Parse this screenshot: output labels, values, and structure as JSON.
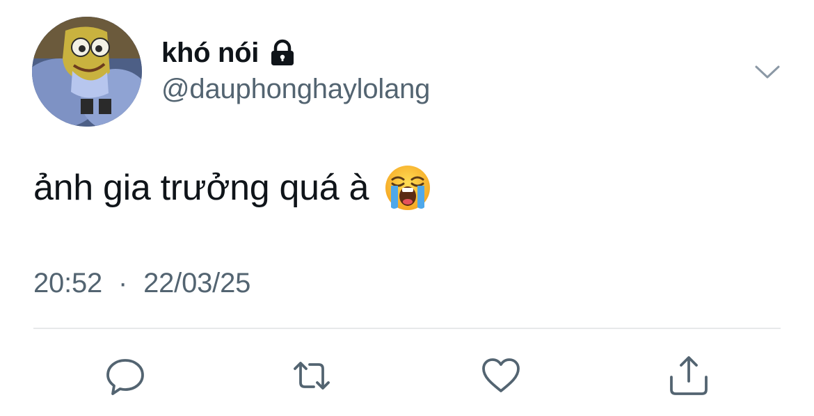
{
  "tweet": {
    "display_name": "khó nói",
    "handle": "@dauphonghaylolang",
    "text": "ảnh gia trưởng quá à",
    "emoji": "loudly-crying-face",
    "time": "20:52",
    "separator": "·",
    "date": "22/03/25",
    "protected": true
  },
  "icons": {
    "lock": "lock-icon",
    "more": "chevron-down-icon",
    "reply": "reply-icon",
    "retweet": "retweet-icon",
    "like": "heart-icon",
    "share": "share-icon"
  },
  "colors": {
    "text_primary": "#0f1419",
    "text_secondary": "#536471",
    "icon": "#536471",
    "divider": "#e7e9ea"
  }
}
